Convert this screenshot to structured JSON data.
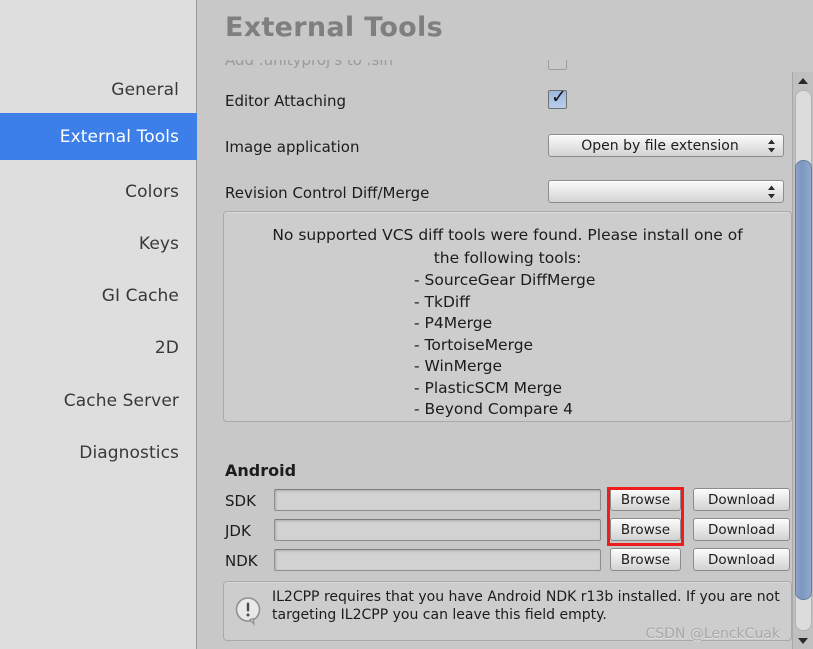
{
  "window": {
    "title": "External Tools",
    "watermark": "CSDN @LenckCuak"
  },
  "sidebar": {
    "items": [
      {
        "label": "General",
        "selected": false
      },
      {
        "label": "External Tools",
        "selected": true
      },
      {
        "label": "Colors",
        "selected": false
      },
      {
        "label": "Keys",
        "selected": false
      },
      {
        "label": "GI Cache",
        "selected": false
      },
      {
        "label": "2D",
        "selected": false
      },
      {
        "label": "Cache Server",
        "selected": false
      },
      {
        "label": "Diagnostics",
        "selected": false
      }
    ]
  },
  "main": {
    "clipped_row": {
      "label": "Add .unityproj's to .sln",
      "checked": false
    },
    "editor_attaching": {
      "label": "Editor Attaching",
      "checked": true
    },
    "image_application": {
      "label": "Image application",
      "value": "Open by file extension"
    },
    "revision_control": {
      "label": "Revision Control Diff/Merge",
      "value": ""
    },
    "vcs_help": {
      "message": "No supported VCS diff tools were found. Please install one of the following tools:",
      "tools": [
        "- SourceGear DiffMerge",
        "- TkDiff",
        "- P4Merge",
        "- TortoiseMerge",
        "- WinMerge",
        "- PlasticSCM Merge",
        "- Beyond Compare 4"
      ]
    },
    "android": {
      "heading": "Android",
      "rows": [
        {
          "label": "SDK",
          "value": "",
          "browse": "Browse",
          "download": "Download"
        },
        {
          "label": "JDK",
          "value": "",
          "browse": "Browse",
          "download": "Download"
        },
        {
          "label": "NDK",
          "value": "",
          "browse": "Browse",
          "download": "Download"
        }
      ]
    },
    "il2cpp_help": {
      "text": "IL2CPP requires that you have Android NDK r13b installed. If you are not targeting IL2CPP you can leave this field empty."
    }
  },
  "annotation": {
    "color": "#ee1c1c"
  },
  "colors": {
    "sidebar_bg": "#dedede",
    "content_bg": "#c8c8c8",
    "selection": "#3d7fe8",
    "scrollbar_thumb": "#7d96bf"
  }
}
